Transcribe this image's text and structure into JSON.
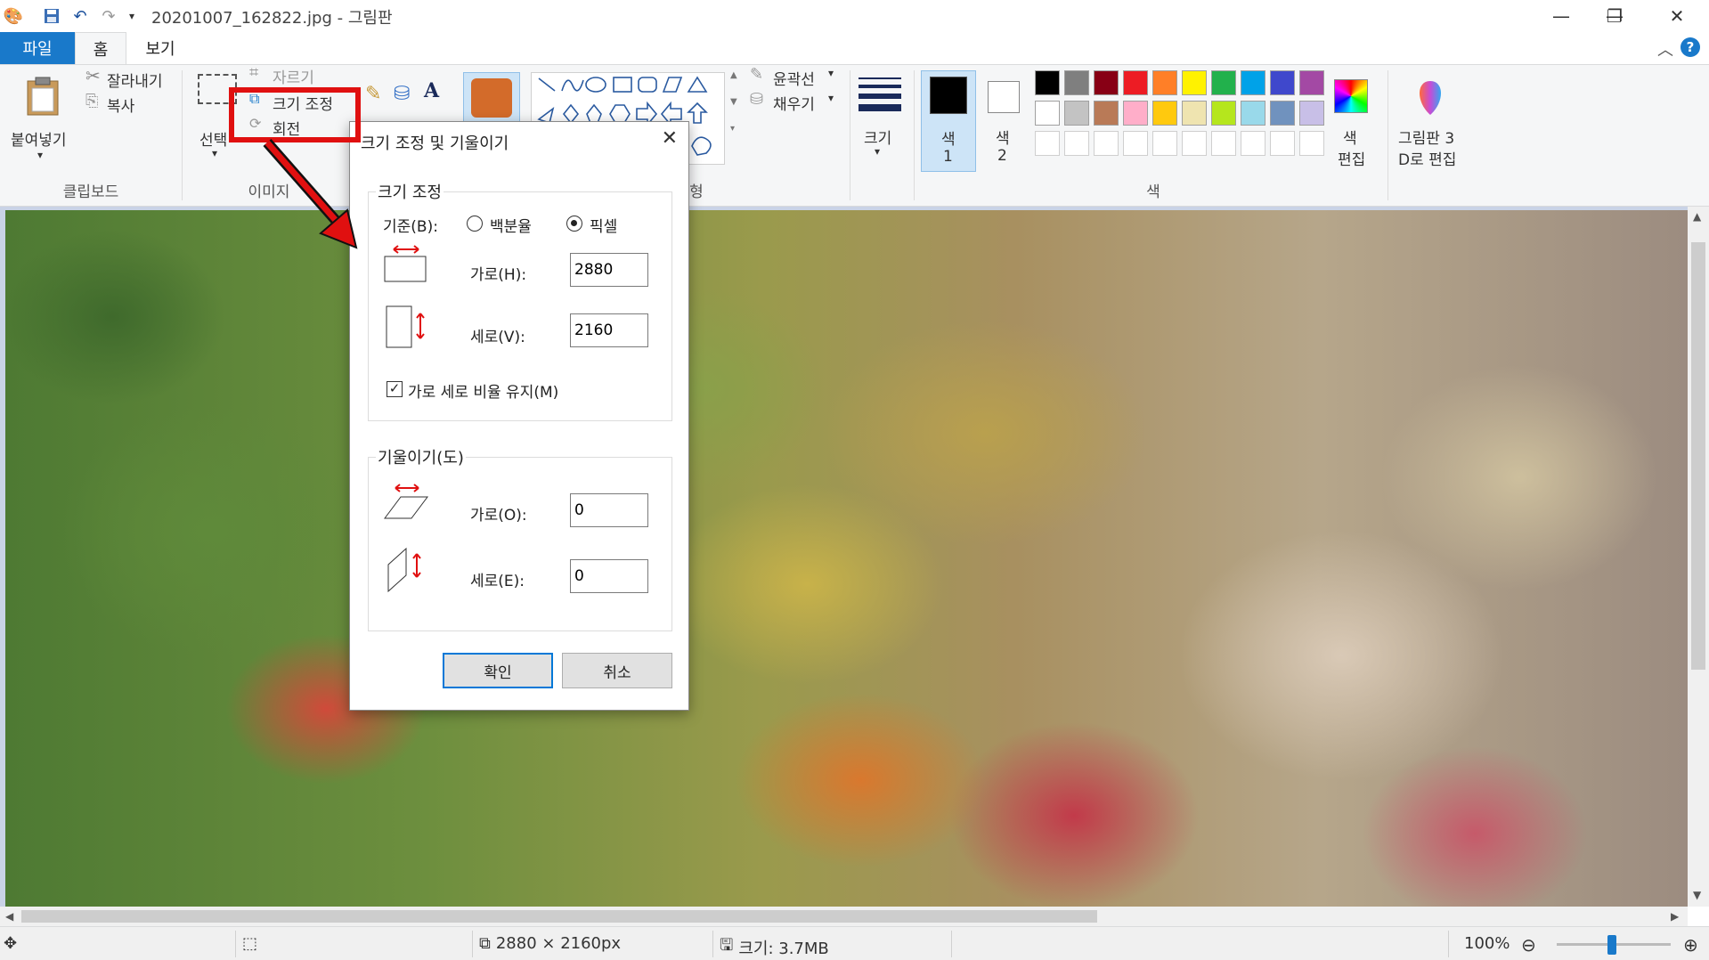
{
  "titlebar": {
    "title": "20201007_162822.jpg - 그림판",
    "quick_access": [
      "save-icon",
      "undo-icon",
      "redo-icon",
      "customize-icon"
    ],
    "minimize": "—",
    "restore": "❐",
    "close": "✕"
  },
  "tabs": {
    "file": "파일",
    "home": "홈",
    "view": "보기"
  },
  "ribbon": {
    "clipboard": {
      "paste": "붙여넣기",
      "cut": "잘라내기",
      "copy": "복사",
      "label": "클립보드"
    },
    "image": {
      "select": "선택",
      "crop": "자르기",
      "resize": "크기 조정",
      "rotate": "회전",
      "label": "이미지"
    },
    "shapes": {
      "outline": "윤곽선",
      "fill": "채우기",
      "label": "형"
    },
    "size": "크기",
    "color1": "색\n1",
    "color1_a": "색",
    "color1_b": "1",
    "color2_a": "색",
    "color2_b": "2",
    "edit_colors_a": "색",
    "edit_colors_b": "편집",
    "paint3d_a": "그림판 3",
    "paint3d_b": "D로 편집",
    "colors_label": "색",
    "palette_row1": [
      "#000000",
      "#7f7f7f",
      "#880015",
      "#ed1c24",
      "#ff7f27",
      "#fff200",
      "#22b14c",
      "#00a2e8",
      "#3f48cc",
      "#a349a4"
    ],
    "palette_row2": [
      "#ffffff",
      "#c3c3c3",
      "#b97a57",
      "#ffaec9",
      "#ffc90e",
      "#efe4b0",
      "#b5e61d",
      "#99d9ea",
      "#7092be",
      "#c8bfe7"
    ]
  },
  "dialog": {
    "title": "크기 조정 및 기울이기",
    "resize_legend": "크기 조정",
    "basis_label": "기준(B):",
    "percent": "백분율",
    "pixel": "픽셀",
    "horizontal_label": "가로(H):",
    "horizontal_value": "2880",
    "vertical_label": "세로(V):",
    "vertical_value": "2160",
    "keep_ratio": "가로 세로 비율 유지(M)",
    "skew_legend": "기울이기(도)",
    "skew_h_label": "가로(O):",
    "skew_h_value": "0",
    "skew_v_label": "세로(E):",
    "skew_v_value": "0",
    "ok": "확인",
    "cancel": "취소"
  },
  "status": {
    "dimensions": "2880 × 2160px",
    "size": "크기: 3.7MB",
    "zoom": "100%"
  },
  "accent": "#1979ca",
  "highlight": "#e01010"
}
